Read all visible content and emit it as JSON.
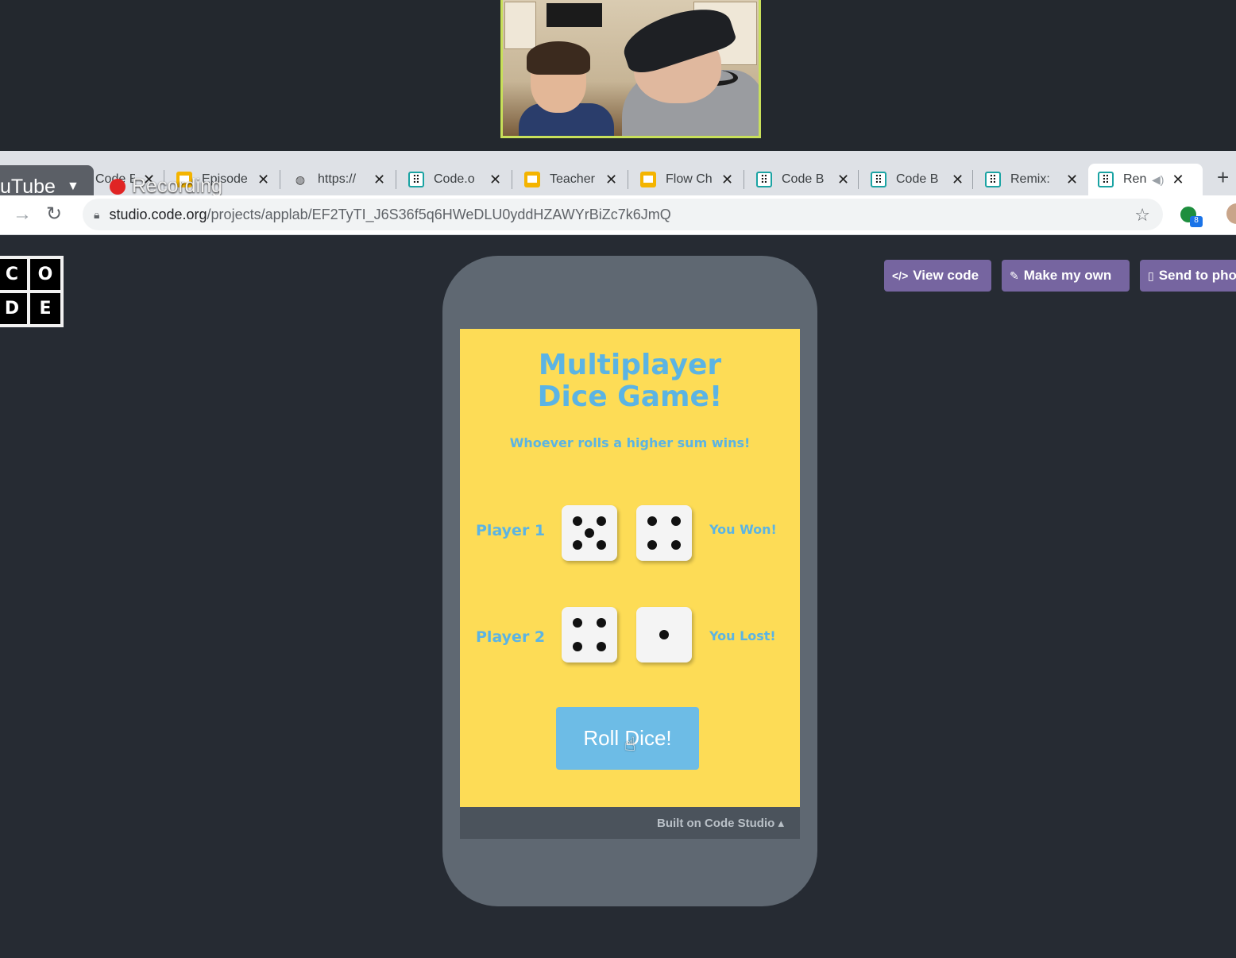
{
  "browser": {
    "youtube_label": "uTube",
    "recording_label": "Recording",
    "tabs": [
      {
        "label": "Code B",
        "icon": "pin-icon"
      },
      {
        "label": "Episode",
        "icon": "slides-icon"
      },
      {
        "label": "https://",
        "icon": "globe-icon"
      },
      {
        "label": "Code.o",
        "icon": "code-studio-icon"
      },
      {
        "label": "Teacher",
        "icon": "slides-icon"
      },
      {
        "label": "Flow Ch",
        "icon": "slides-icon"
      },
      {
        "label": "Code B",
        "icon": "code-studio-icon"
      },
      {
        "label": "Code B",
        "icon": "code-studio-icon"
      },
      {
        "label": "Remix:",
        "icon": "code-studio-icon"
      },
      {
        "label": "Ren",
        "icon": "code-studio-icon",
        "active": true
      }
    ],
    "url_host": "studio.code.org",
    "url_path": "/projects/applab/EF2TyTI_J6S36f5q6HWeDLU0yddHZAWYrBiZc7k6JmQ",
    "extension_badge": "8"
  },
  "page": {
    "logo_letters": [
      "C",
      "O",
      "D",
      "E"
    ],
    "actions": {
      "view_code": "View code",
      "make_my_own": "Make my own",
      "send_to_phone": "Send to pho"
    },
    "footer": "Built on Code Studio ▴"
  },
  "game": {
    "title_line1": "Multiplayer",
    "title_line2": "Dice Game!",
    "subtitle": "Whoever rolls a higher sum wins!",
    "player1": {
      "label": "Player 1",
      "dice": [
        5,
        4
      ],
      "result": "You Won!"
    },
    "player2": {
      "label": "Player 2",
      "dice": [
        4,
        1
      ],
      "result": "You Lost!"
    },
    "roll_button": "Roll Dice!"
  }
}
